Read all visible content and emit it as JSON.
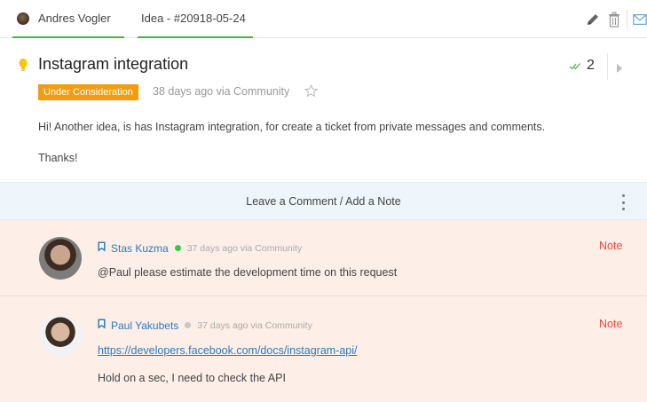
{
  "tabs": {
    "user_tab": "Andres Vogler",
    "idea_tab": "Idea - #20918-05-24"
  },
  "toolbar": {
    "icons": [
      "pencil-icon",
      "trash-icon",
      "envelope-icon"
    ]
  },
  "idea": {
    "title": "Instagram integration",
    "status": "Under Consideration",
    "meta": "38 days ago via Community",
    "votes": "2",
    "body": "Hi! Another idea, is has Instagram integration, for create a ticket from private messages and comments.",
    "closing": "Thanks!"
  },
  "comment_bar": {
    "label": "Leave a Comment / Add a Note"
  },
  "notes": [
    {
      "author": "Stas Kuzma",
      "online": true,
      "when": "37 days ago via Community",
      "tag": "Note",
      "text": "@Paul please estimate the development time on this request"
    },
    {
      "author": "Paul Yakubets",
      "online": false,
      "when": "37 days ago via Community",
      "tag": "Note",
      "link": "https://developers.facebook.com/docs/instagram-api/",
      "text": "Hold on a sec, I need to check the API"
    }
  ],
  "colors": {
    "accent_green": "#4caf50",
    "status_orange": "#f39c12",
    "link_blue": "#2a7bc0",
    "note_red": "#e74c3c",
    "note_bg": "#fdeee8",
    "bar_bg": "#eef6fb"
  }
}
